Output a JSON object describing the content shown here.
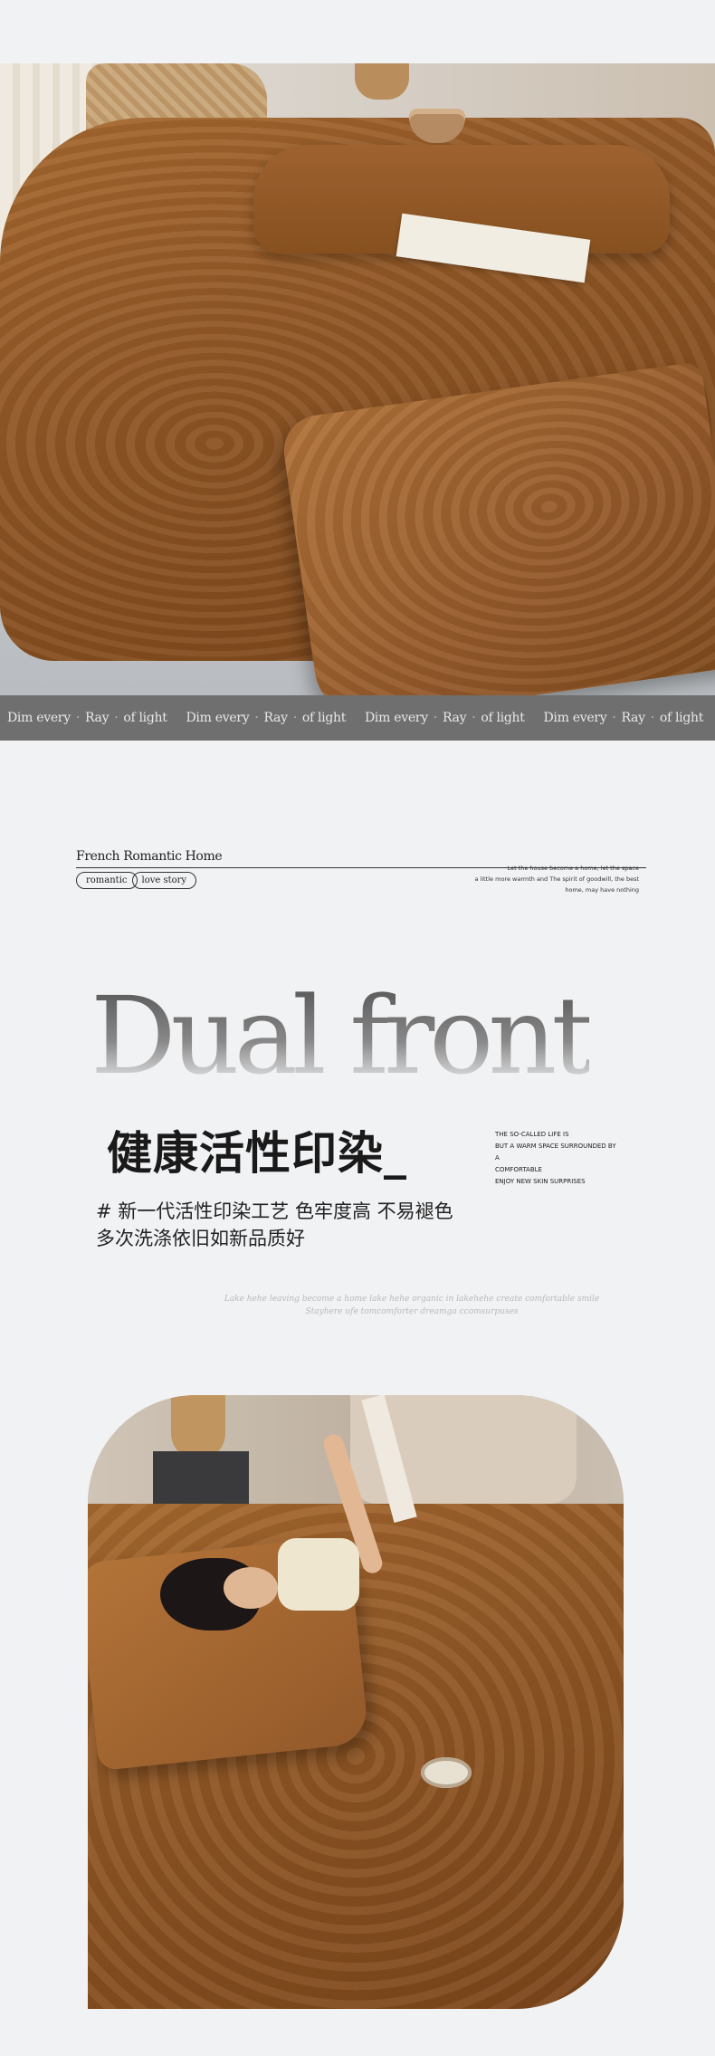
{
  "marquee": {
    "items": [
      {
        "a": "Dim every",
        "b": "Ray",
        "c": "of light"
      },
      {
        "a": "Dim every",
        "b": "Ray",
        "c": "of light"
      },
      {
        "a": "Dim every",
        "b": "Ray",
        "c": "of light"
      },
      {
        "a": "Dim every",
        "b": "Ray",
        "c": "of light"
      }
    ],
    "separator": "·"
  },
  "brand": {
    "title": "French Romantic Home",
    "pill_1": "romantic",
    "pill_2": "love story",
    "tagline_1": "Let the house become a home, let the space",
    "tagline_2": "a little more warmth and The spirit of goodwill, the best",
    "tagline_3": "home, may have nothing"
  },
  "headline": {
    "big": "Dual front",
    "cn_title": "健康活性印染_",
    "side_1": "THE SO-CALLED LIFE IS",
    "side_2": "BUT A WARM SPACE SURROUNDED BY A",
    "side_3": "COMFORTABLE",
    "side_4": "ENJOY NEW SKIN SURPRISES",
    "desc_1": "# 新一代活性印染工艺 色牢度高 不易褪色",
    "desc_2": "多次洗涤依旧如新品质好",
    "script_1": "Lake hehe leaving become a home lake hehe organic in lakehehe create comfortable smile",
    "script_2": "Stayhere ufe tomcomforter dreamga ccomsurpuses"
  },
  "colors": {
    "background": "#f1f2f4",
    "bar": "#6f6f6f",
    "fabric": "#8e5525"
  }
}
